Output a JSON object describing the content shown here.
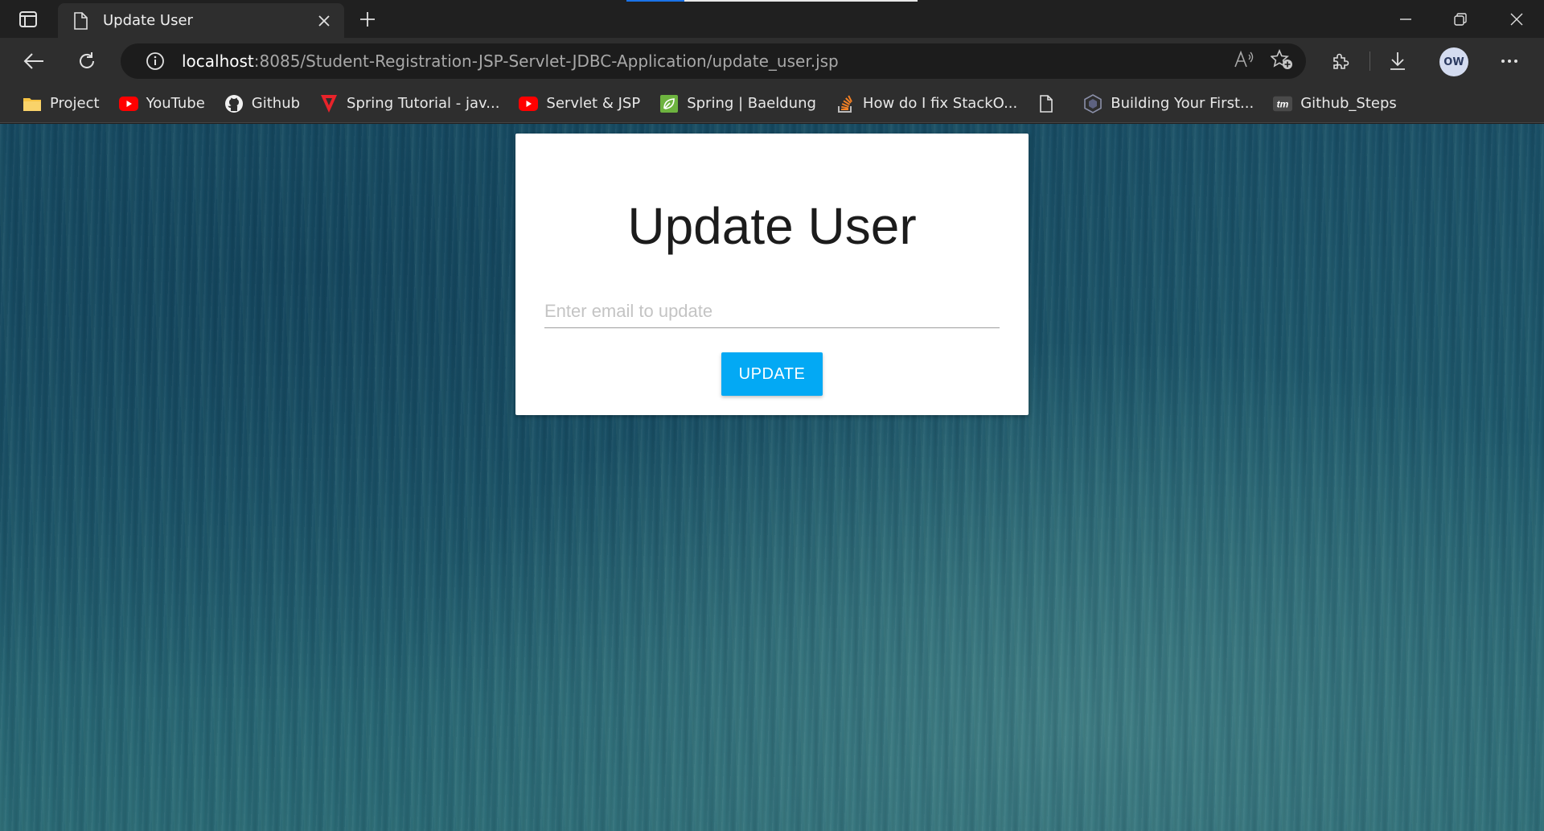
{
  "browser": {
    "tab": {
      "title": "Update User"
    },
    "address": {
      "host": "localhost",
      "rest": ":8085/Student-Registration-JSP-Servlet-JDBC-Application/update_user.jsp"
    },
    "profile_initials": "OW",
    "bookmarks": [
      {
        "label": "Project",
        "icon": "folder-icon"
      },
      {
        "label": "YouTube",
        "icon": "youtube-icon"
      },
      {
        "label": "Github",
        "icon": "github-icon"
      },
      {
        "label": "Spring Tutorial - jav...",
        "icon": "spring-tutorial-icon"
      },
      {
        "label": "Servlet & JSP",
        "icon": "youtube-icon"
      },
      {
        "label": "Spring | Baeldung",
        "icon": "spring-leaf-icon"
      },
      {
        "label": "How do I fix StackO...",
        "icon": "stackoverflow-icon"
      },
      {
        "label": "",
        "icon": "page-icon"
      },
      {
        "label": "Building Your First...",
        "icon": "hexagon-icon"
      },
      {
        "label": "Github_Steps",
        "icon": "tm-icon"
      }
    ]
  },
  "page": {
    "heading": "Update User",
    "email_placeholder": "Enter email to update",
    "email_value": "",
    "update_button": "UPDATE"
  },
  "colors": {
    "button": "#03a9f4",
    "background": "#1f5a6d"
  }
}
